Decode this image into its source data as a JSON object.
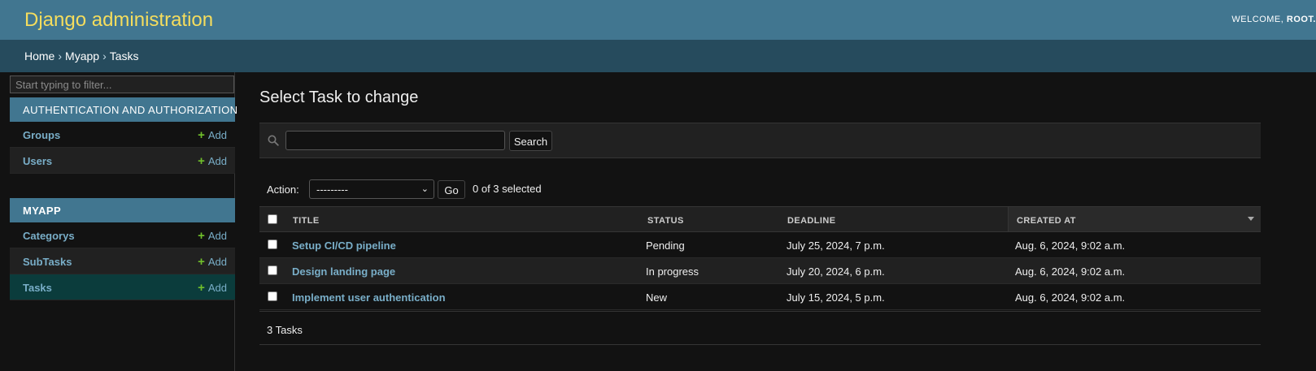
{
  "header": {
    "brand": "Django administration",
    "welcome": "WELCOME, ",
    "user": "ROOT."
  },
  "breadcrumbs": {
    "home": "Home",
    "app": "Myapp",
    "current": "Tasks",
    "separator": "›"
  },
  "sidebar": {
    "filter_placeholder": "Start typing to filter...",
    "modules": [
      {
        "caption": "AUTHENTICATION AND AUTHORIZATION",
        "models": [
          {
            "name": "Groups",
            "add": "Add"
          },
          {
            "name": "Users",
            "add": "Add"
          }
        ]
      },
      {
        "caption": "MYAPP",
        "models": [
          {
            "name": "Categorys",
            "add": "Add"
          },
          {
            "name": "SubTasks",
            "add": "Add"
          },
          {
            "name": "Tasks",
            "add": "Add"
          }
        ]
      }
    ]
  },
  "main": {
    "title": "Select Task to change",
    "search_button": "Search",
    "action_label": "Action:",
    "action_selected": "---------",
    "go_button": "Go",
    "action_counter": "0 of 3 selected",
    "columns": [
      "TITLE",
      "STATUS",
      "DEADLINE",
      "CREATED AT"
    ],
    "rows": [
      {
        "title": "Setup CI/CD pipeline",
        "status": "Pending",
        "deadline": "July 25, 2024, 7 p.m.",
        "created_at": "Aug. 6, 2024, 9:02 a.m."
      },
      {
        "title": "Design landing page",
        "status": "In progress",
        "deadline": "July 20, 2024, 6 p.m.",
        "created_at": "Aug. 6, 2024, 9:02 a.m."
      },
      {
        "title": "Implement user authentication",
        "status": "New",
        "deadline": "July 15, 2024, 5 p.m.",
        "created_at": "Aug. 6, 2024, 9:02 a.m."
      }
    ],
    "paginator": "3 Tasks"
  },
  "colors": {
    "header_bg": "#417690",
    "brand": "#f5dd5d",
    "breadcrumbs_bg": "#264b5d",
    "link": "#79aec8",
    "add_plus": "#70bf2b",
    "body_bg": "#121212"
  },
  "icons": {
    "search": "search-icon",
    "add": "plus-icon",
    "select": "chevron-down-icon",
    "sort": "sort-desc-icon"
  }
}
